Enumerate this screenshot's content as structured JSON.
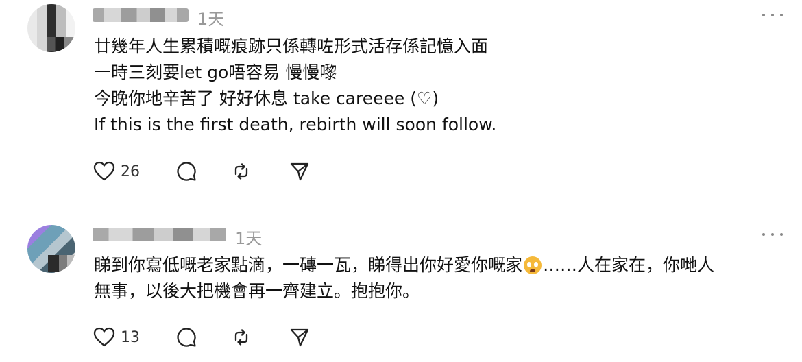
{
  "posts": [
    {
      "timestamp": "1天",
      "lines": [
        "廿幾年人生累積嘅痕跡只係轉咗形式活存係記憶入面",
        "一時三刻要let go唔容易 慢慢嚟",
        "今晚你地辛苦了 好好休息 take careeee (♡)",
        "If this is the first death, rebirth will soon follow."
      ],
      "like_count": "26"
    },
    {
      "timestamp": "1天",
      "line1_before_emoji": "睇到你寫低嘅老家點滴，一磚一瓦，睇得出你好愛你嘅家",
      "line1_after_emoji": "……人在家在，你哋人",
      "line2": "無事，以後大把機會再一齊建立。抱抱你。",
      "like_count": "13"
    }
  ],
  "icons": {
    "like": "heart-icon",
    "reply": "comment-bubble-icon",
    "repost": "repost-arrows-icon",
    "share": "send-icon",
    "more": "more-dots-icon",
    "emoji": "pleading-face-emoji"
  }
}
